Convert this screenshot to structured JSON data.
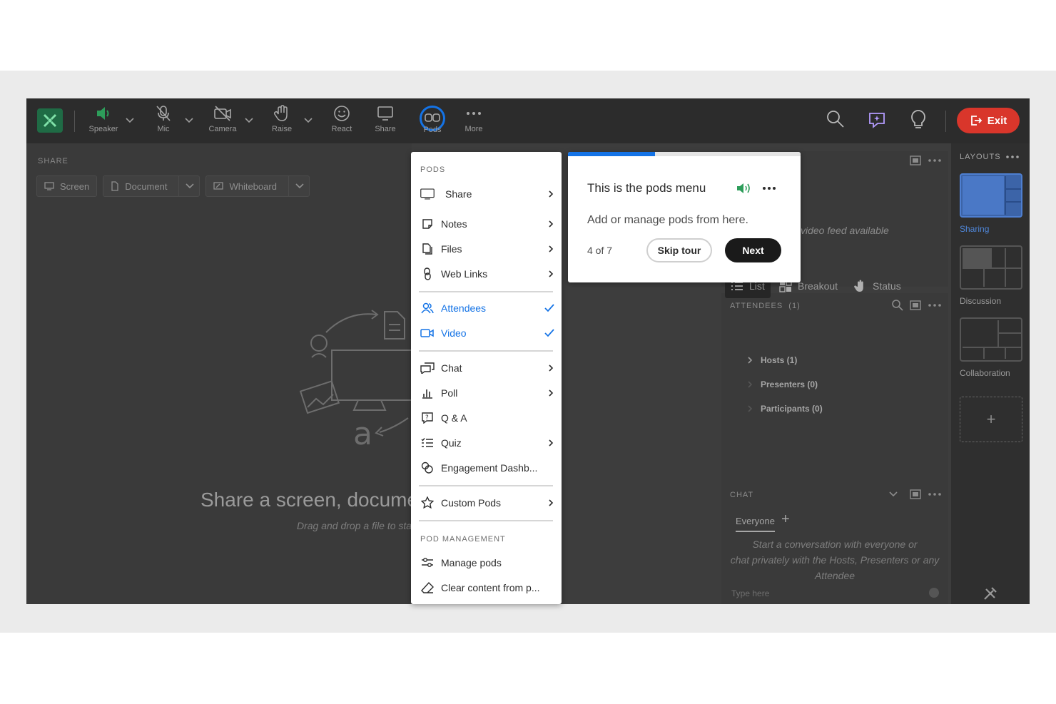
{
  "toolbar": {
    "speaker": "Speaker",
    "mic": "Mic",
    "camera": "Camera",
    "raise": "Raise",
    "react": "React",
    "share": "Share",
    "pods": "Pods",
    "more": "More",
    "exit": "Exit"
  },
  "share_pod": {
    "header": "SHARE",
    "screen": "Screen",
    "document": "Document",
    "whiteboard": "Whiteboard",
    "title": "Share a screen, documen",
    "subtitle": "Drag and drop a file to sta"
  },
  "video_pod": {
    "message": "video feed available"
  },
  "attendees_pod": {
    "header": "ATTENDEES  (1)",
    "tab_list": "List",
    "tab_breakout": "Breakout",
    "tab_status": "Status",
    "hosts": "Hosts (1)",
    "presenters": "Presenters (0)",
    "participants": "Participants (0)"
  },
  "chat_pod": {
    "header": "CHAT",
    "tab_everyone": "Everyone",
    "hint_1": "Start a conversation with everyone or",
    "hint_2": "chat privately with the Hosts, Presenters or any",
    "hint_3": "Attendee",
    "placeholder": "Type here"
  },
  "layouts": {
    "header": "LAYOUTS",
    "sharing": "Sharing",
    "discussion": "Discussion",
    "collaboration": "Collaboration",
    "add": "+"
  },
  "pods_menu": {
    "section_pods": "PODS",
    "share": "Share",
    "notes": "Notes",
    "files": "Files",
    "web_links": "Web Links",
    "attendees": "Attendees",
    "video": "Video",
    "chat": "Chat",
    "poll": "Poll",
    "qa": "Q & A",
    "quiz": "Quiz",
    "engagement": "Engagement Dashb...",
    "custom_pods": "Custom Pods",
    "section_management": "POD MANAGEMENT",
    "manage_pods": "Manage pods",
    "clear_content": "Clear content from p..."
  },
  "tour": {
    "title": "This is the pods menu",
    "body": "Add or manage pods from here.",
    "step": "4 of 7",
    "progress": 0.375,
    "skip": "Skip tour",
    "next": "Next"
  },
  "colors": {
    "accent": "#1473e6",
    "exit_red": "#d9362b",
    "speaker_green": "#2d9d5a"
  }
}
